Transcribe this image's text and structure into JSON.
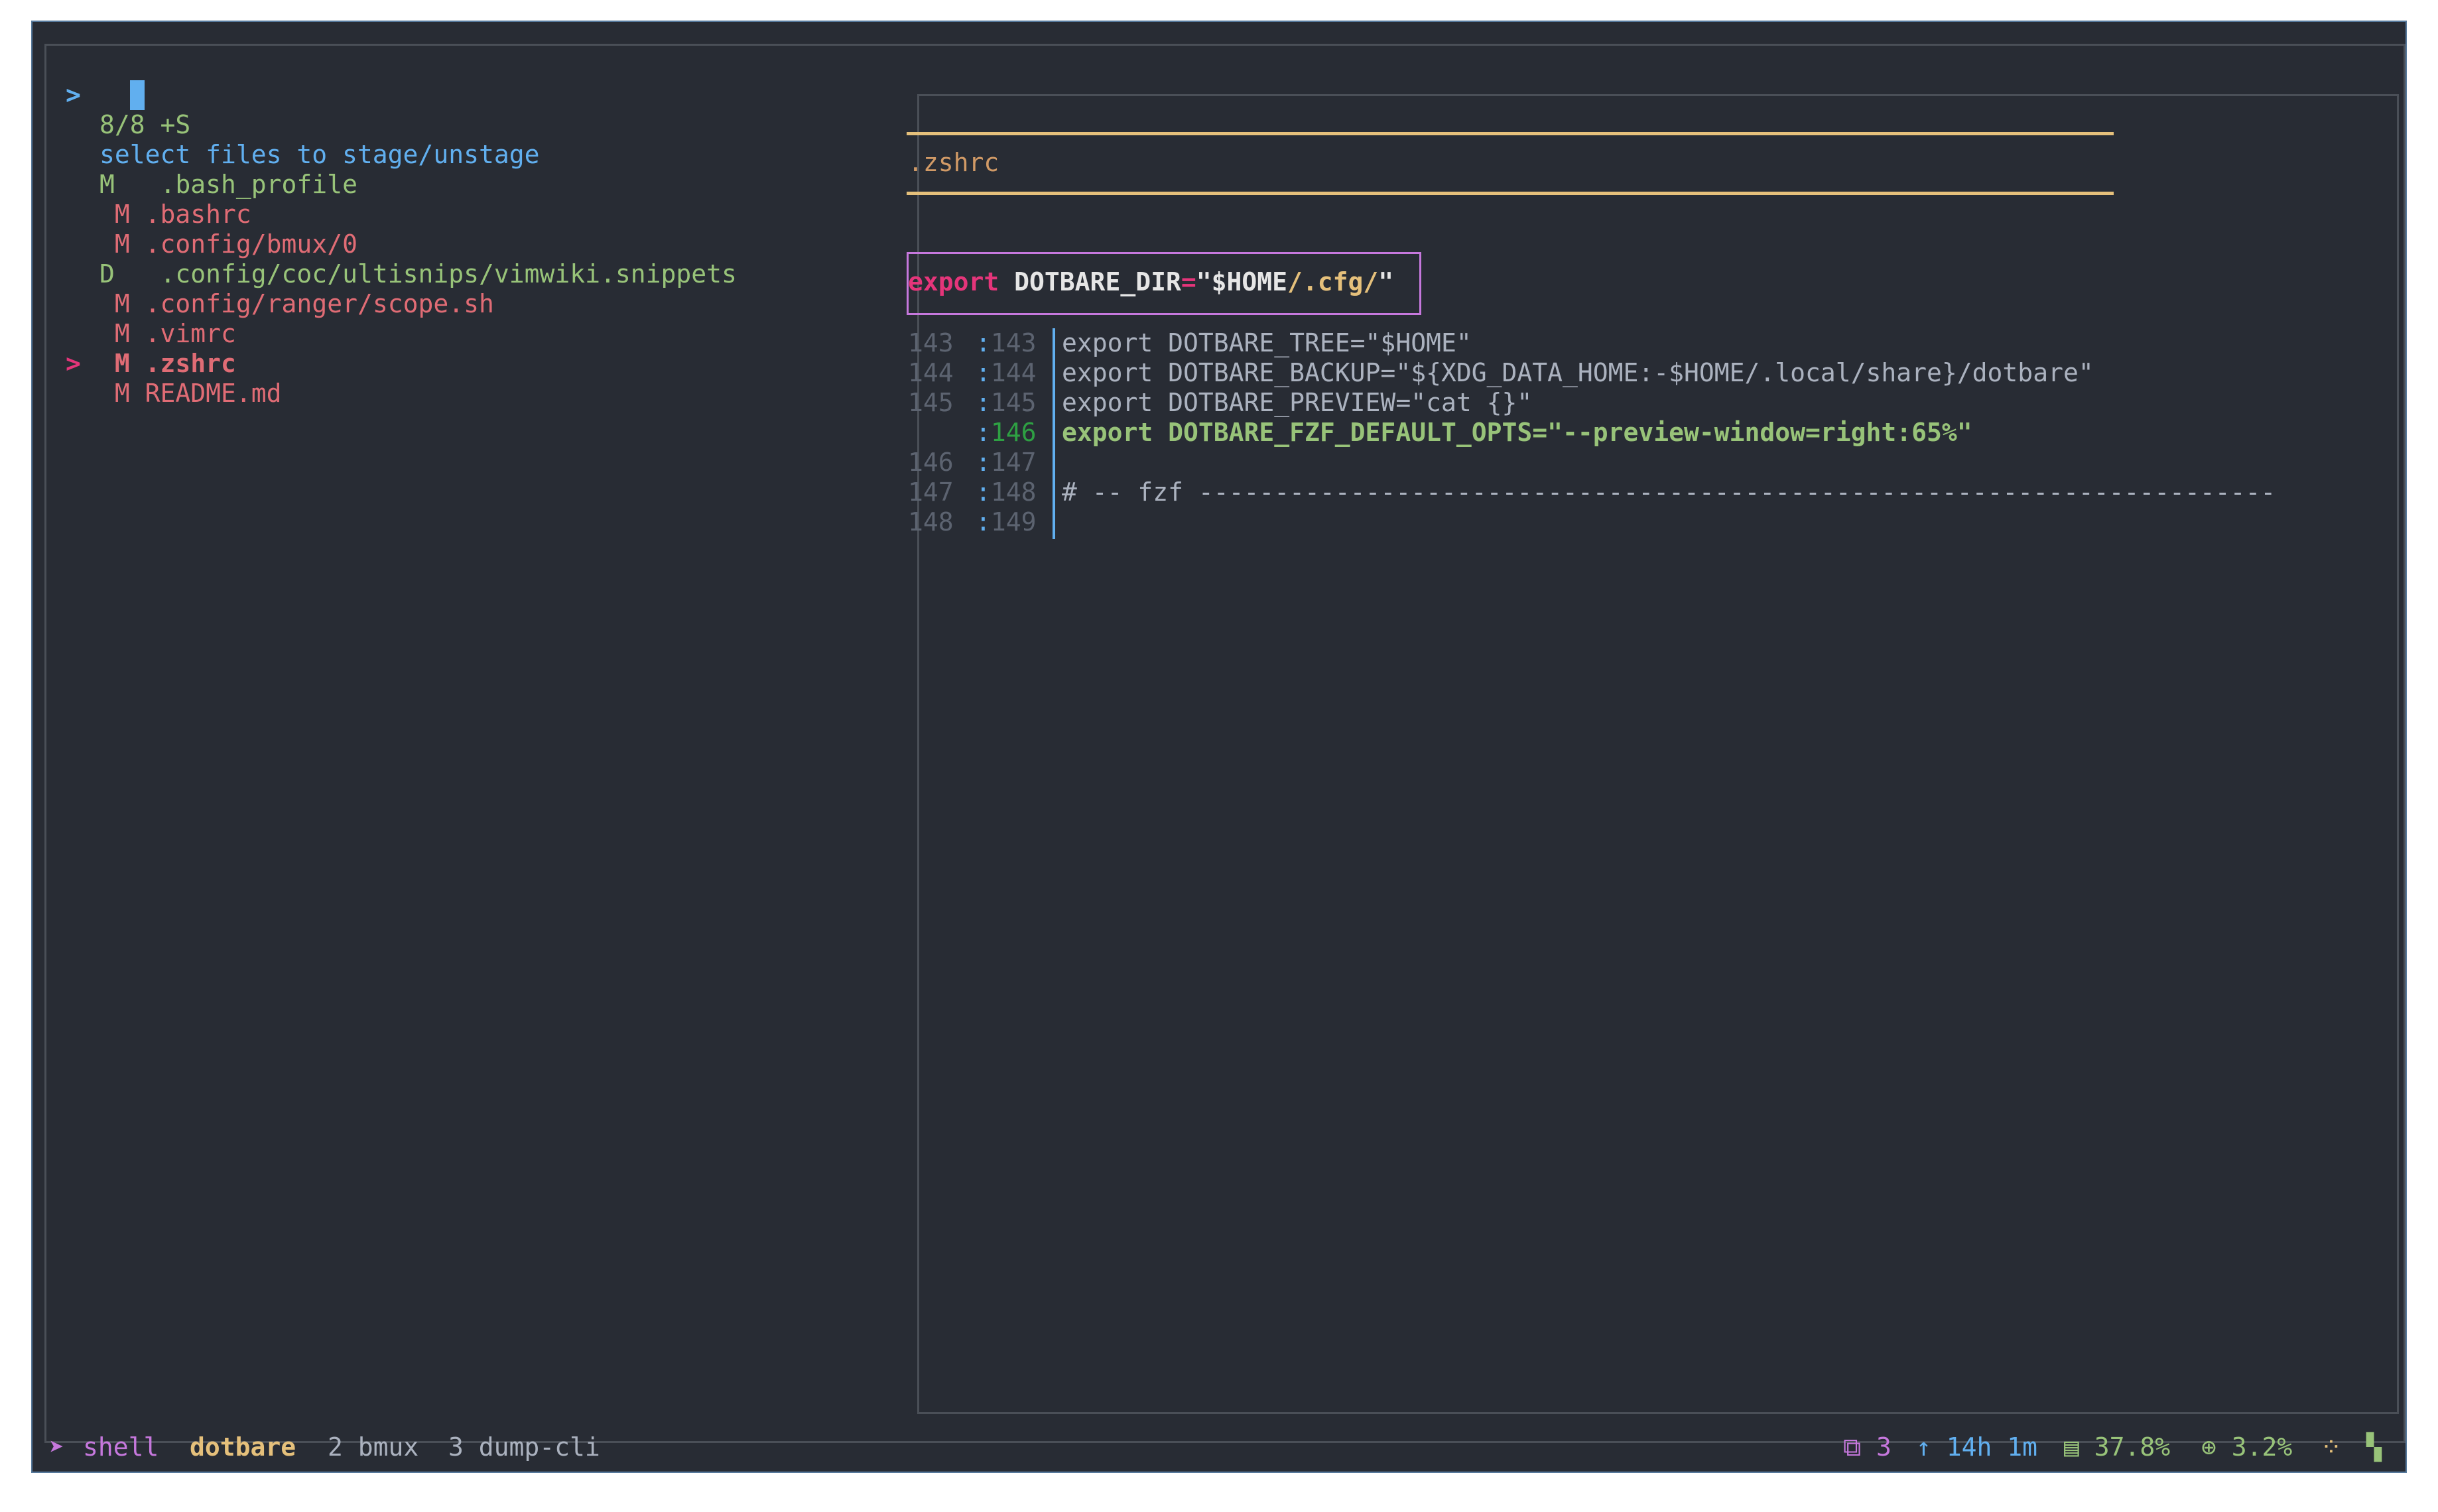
{
  "prompt": {
    "symbol": ">"
  },
  "list": {
    "count": "8/8 +S",
    "header": "select files to stage/unstage",
    "items": [
      {
        "status": "M ",
        "path": ".bash_profile"
      },
      {
        "status": " M",
        "path": ".bashrc"
      },
      {
        "status": " M",
        "path": ".config/bmux/0"
      },
      {
        "status": "D ",
        "path": ".config/coc/ultisnips/vimwiki.snippets"
      },
      {
        "status": " M",
        "path": ".config/ranger/scope.sh"
      },
      {
        "status": " M",
        "path": ".vimrc"
      },
      {
        "status": " M",
        "path": ".zshrc",
        "pointer": ">"
      },
      {
        "status": " M",
        "path": "README.md"
      }
    ]
  },
  "preview": {
    "filename": ".zshrc",
    "hunk": {
      "keyword": "export",
      "name": "DOTBARE_DIR",
      "eq": "=",
      "q1": "\"$HOME",
      "path": "/.cfg/",
      "q2": "\""
    },
    "lines": [
      {
        "old": "143",
        "new": "143",
        "code": "export DOTBARE_TREE=\"$HOME\""
      },
      {
        "old": "144",
        "new": "144",
        "code": "export DOTBARE_BACKUP=\"${XDG_DATA_HOME:-$HOME/.local/share}/dotbare\""
      },
      {
        "old": "145",
        "new": "145",
        "code": "export DOTBARE_PREVIEW=\"cat {}\""
      },
      {
        "old": "",
        "new": "146",
        "code": "export DOTBARE_FZF_DEFAULT_OPTS=\"--preview-window=right:65%\"",
        "added": true
      },
      {
        "old": "146",
        "new": "147",
        "code": ""
      },
      {
        "old": "147",
        "new": "148",
        "code": "# -- fzf -----------------------------------------------------------------------"
      },
      {
        "old": "148",
        "new": "149",
        "code": ""
      }
    ]
  },
  "statusbar": {
    "session_icon": "send-arrow-icon",
    "session": "shell",
    "windows": [
      {
        "label": "dotbare",
        "active": true
      },
      {
        "label": "2 bmux"
      },
      {
        "label": "3 dump-cli"
      }
    ],
    "panes": "3",
    "uptime": "14h 1m",
    "memory": "37.8%",
    "cpu": "3.2%"
  },
  "colors": {
    "background": "#282c34",
    "border": "#56799c",
    "green": "#98c379",
    "blue": "#61afef",
    "red": "#e06c75",
    "pink": "#e5357a",
    "yellow": "#e5c07b",
    "purple": "#c678dd"
  }
}
